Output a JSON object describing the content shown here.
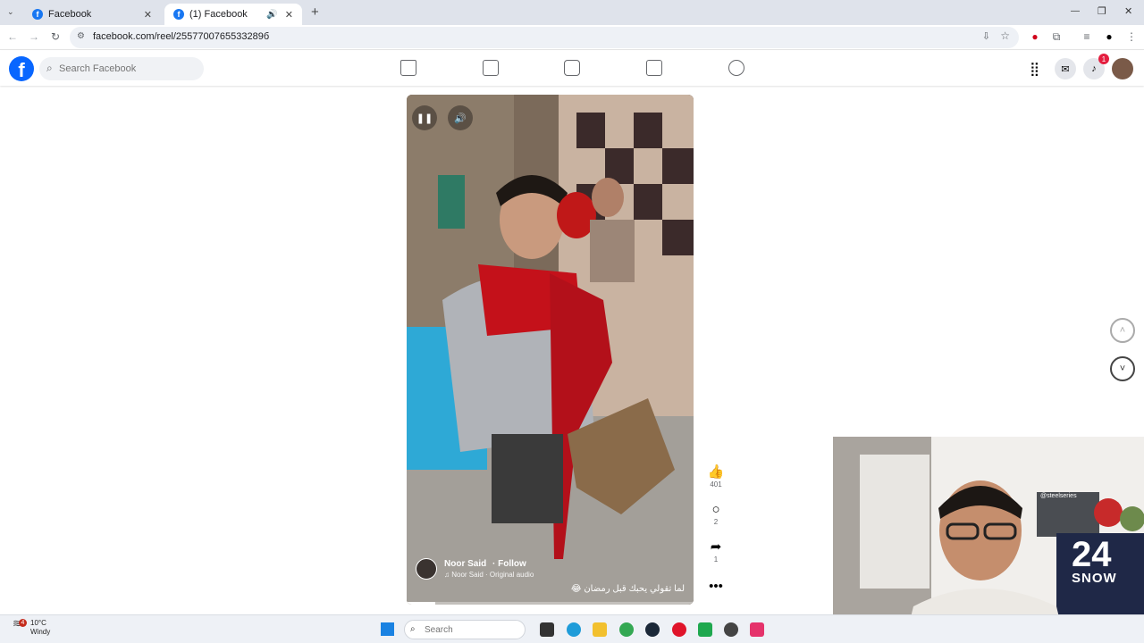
{
  "browser": {
    "tabs": [
      {
        "title": "Facebook",
        "close": "✕"
      },
      {
        "title": "(1) Facebook",
        "close": "✕",
        "audio": "🔊"
      }
    ],
    "new_tab": "+",
    "window_controls": {
      "minimize": "—",
      "restore": "❐",
      "close": "✕"
    },
    "url": "facebook.com/reel/2557700765533289б"
  },
  "facebook": {
    "logo": "f",
    "search_placeholder": "Search Facebook",
    "notification_count": "1"
  },
  "reel": {
    "author": "Noor Said",
    "follow": "· Follow",
    "audio": "♫ Noor Said · Original audio",
    "caption": "😂 لما تقولي يحبك قبل رمضان",
    "progress": 0.1
  },
  "actions": {
    "likes": "401",
    "comments": "2",
    "shares": "1"
  },
  "taskbar": {
    "weather_temp": "10°C",
    "weather_desc": "Windy",
    "weather_badge": "4",
    "search_placeholder": "Search"
  },
  "webcam": {
    "jersey_number": "24",
    "jersey_name": "SNOW",
    "shelf_label": "@steelseries"
  },
  "colors": {
    "fb_blue": "#0866ff",
    "badge_red": "#e41e3f",
    "tabstrip": "#dfe3eb"
  }
}
